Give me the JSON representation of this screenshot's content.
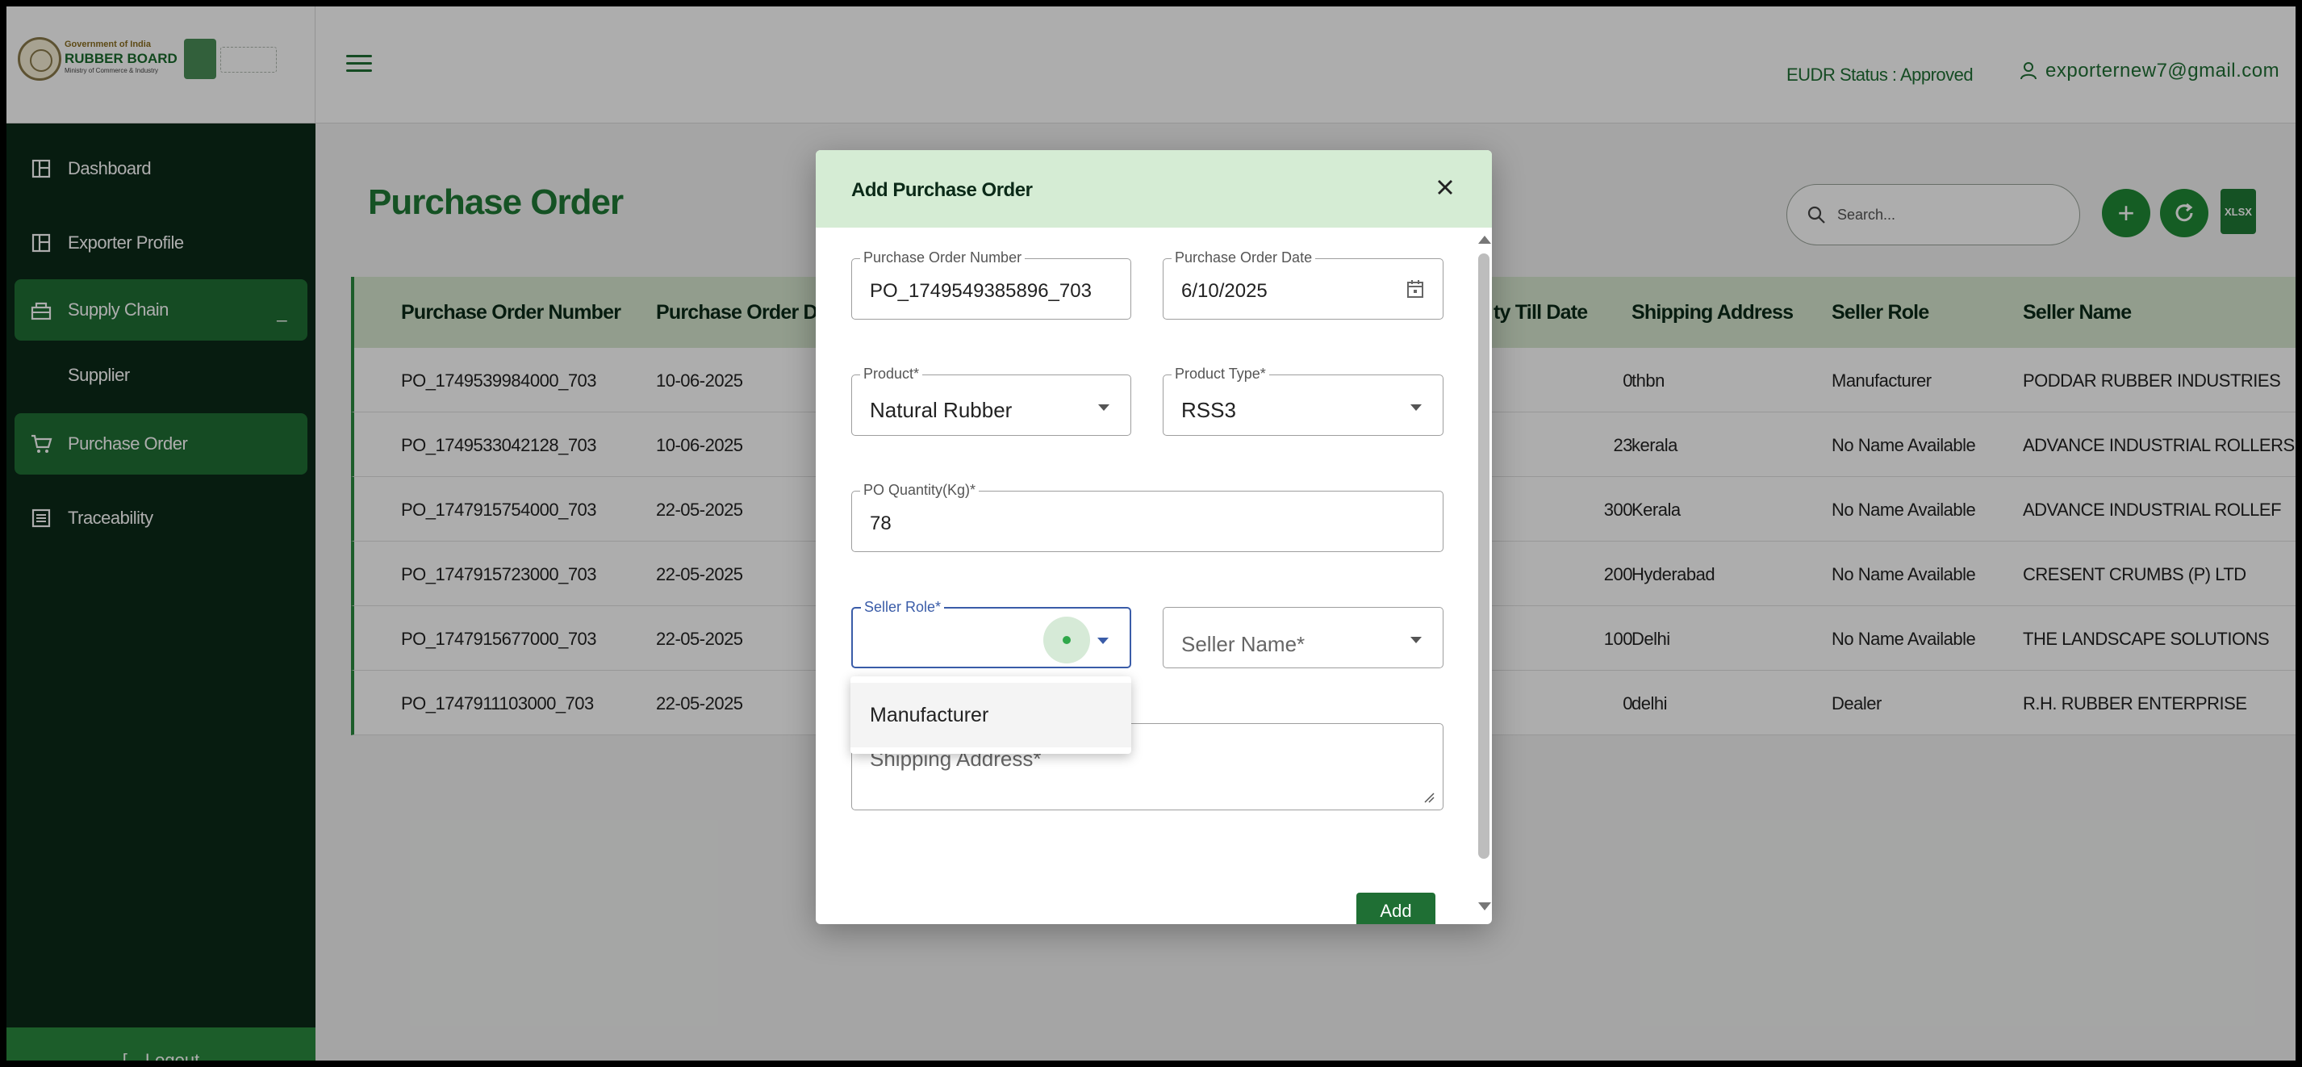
{
  "logo": {
    "line1": "Government of India",
    "line2": "RUBBER BOARD",
    "line3": "Ministry of Commerce & Industry"
  },
  "sidebar": {
    "items": [
      {
        "label": "Dashboard",
        "icon": "dashboard-icon"
      },
      {
        "label": "Exporter Profile",
        "icon": "dashboard-icon"
      },
      {
        "label": "Supply Chain",
        "icon": "supply-chain-icon",
        "collapse": "_"
      },
      {
        "label": "Supplier"
      },
      {
        "label": "Purchase Order",
        "icon": "cart-icon"
      },
      {
        "label": "Traceability",
        "icon": "list-icon"
      }
    ],
    "logout": "[→Logout"
  },
  "topbar": {
    "eudr_status": "EUDR Status : Approved",
    "user_email": "exporternew7@gmail.com"
  },
  "page": {
    "title": "Purchase Order",
    "search_placeholder": "Search...",
    "xlsx_label": "XLSX"
  },
  "table": {
    "headers": [
      "Purchase Order Number",
      "Purchase Order Da",
      "ty Till Date",
      "Shipping Address",
      "Seller Role",
      "Seller Name"
    ],
    "rows": [
      [
        "PO_1749539984000_703",
        "10-06-2025",
        "0",
        "thbn",
        "Manufacturer",
        "PODDAR RUBBER INDUSTRIES"
      ],
      [
        "PO_1749533042128_703",
        "10-06-2025",
        "23",
        "kerala",
        "No Name Available",
        "ADVANCE INDUSTRIAL ROLLERS"
      ],
      [
        "PO_1747915754000_703",
        "22-05-2025",
        "300",
        "Kerala",
        "No Name Available",
        "ADVANCE INDUSTRIAL ROLLEF"
      ],
      [
        "PO_1747915723000_703",
        "22-05-2025",
        "200",
        "Hyderabad",
        "No Name Available",
        "CRESENT CRUMBS (P) LTD"
      ],
      [
        "PO_1747915677000_703",
        "22-05-2025",
        "100",
        "Delhi",
        "No Name Available",
        "THE LANDSCAPE SOLUTIONS"
      ],
      [
        "PO_1747911103000_703",
        "22-05-2025",
        "0",
        "delhi",
        "Dealer",
        "R.H. RUBBER ENTERPRISE"
      ]
    ]
  },
  "modal": {
    "title": "Add Purchase Order",
    "po_number_label": "Purchase Order Number",
    "po_number_value": "PO_1749549385896_703",
    "po_date_label": "Purchase Order Date",
    "po_date_value": "6/10/2025",
    "product_label": "Product*",
    "product_value": "Natural Rubber",
    "product_type_label": "Product Type*",
    "product_type_value": "RSS3",
    "quantity_label": "PO Quantity(Kg)*",
    "quantity_value": "78",
    "seller_role_label": "Seller Role*",
    "seller_role_value": "",
    "seller_name_placeholder": "Seller Name*",
    "shipping_placeholder": "Shipping Address*",
    "add_button": "Add",
    "seller_role_options": [
      "Manufacturer"
    ]
  },
  "colors": {
    "sidebar_bg": "#0b2a18",
    "accent_green": "#1f6f34",
    "modal_header": "#d5ecd4",
    "focus_blue": "#3a5ca8"
  }
}
